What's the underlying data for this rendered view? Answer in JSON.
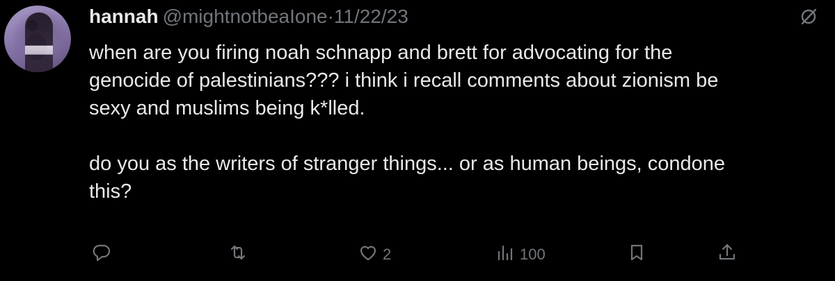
{
  "tweet": {
    "author": {
      "display_name": "hannah",
      "handle": "@mightnotbeaIone",
      "avatar_icon": "user-avatar"
    },
    "separator": "·",
    "date": "11/22/23",
    "grok_icon": "grok-icon",
    "text_lines": [
      "when are you firing noah schnapp and brett for advocating for the",
      "genocide of palestinians??? i think i recall comments about zionism be",
      "sexy and muslims being k*lled.",
      "",
      "do you as the writers of stranger things... or as human beings, condone",
      "this?"
    ],
    "actions": {
      "reply": {
        "icon": "reply-icon",
        "count": ""
      },
      "retweet": {
        "icon": "retweet-icon",
        "count": ""
      },
      "like": {
        "icon": "heart-icon",
        "count": "2"
      },
      "views": {
        "icon": "analytics-icon",
        "count": "100"
      },
      "bookmark": {
        "icon": "bookmark-icon"
      },
      "share": {
        "icon": "share-icon"
      }
    }
  },
  "colors": {
    "background": "#000000",
    "primary_text": "#e7e9ea",
    "secondary_text": "#71767b"
  }
}
